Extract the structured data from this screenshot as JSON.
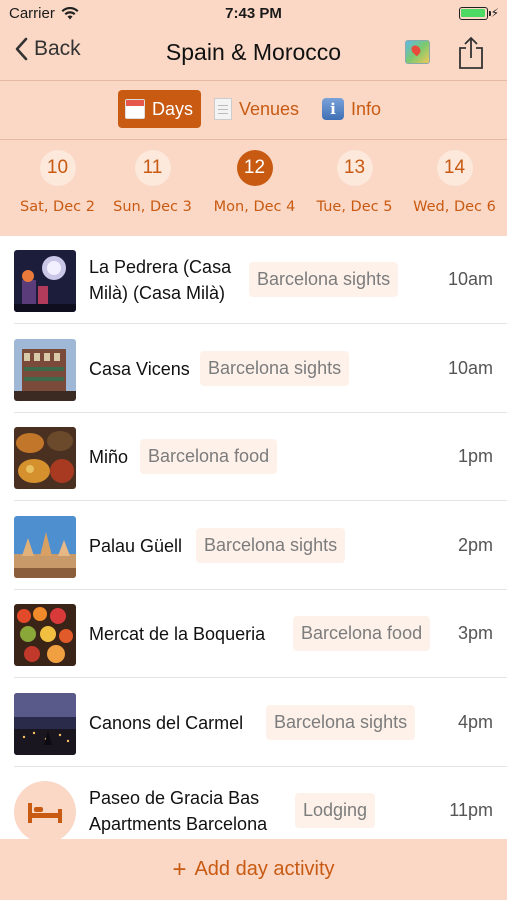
{
  "status": {
    "carrier": "Carrier",
    "time": "7:43 PM",
    "battery_level": 1.0
  },
  "nav": {
    "back_label": "Back",
    "title": "Spain & Morocco",
    "map_icon": "map-icon",
    "share_icon": "share-icon"
  },
  "segments": [
    {
      "label": "Days",
      "icon": "calendar-icon",
      "selected": true
    },
    {
      "label": "Venues",
      "icon": "document-icon",
      "selected": false
    },
    {
      "label": "Info",
      "icon": "info-icon",
      "selected": false
    }
  ],
  "days": [
    {
      "number": "10",
      "label": "Sat, Dec 2",
      "selected": false
    },
    {
      "number": "11",
      "label": "Sun, Dec 3",
      "selected": false
    },
    {
      "number": "12",
      "label": "Mon, Dec 4",
      "selected": true
    },
    {
      "number": "13",
      "label": "Tue, Dec 5",
      "selected": false
    },
    {
      "number": "14",
      "label": "Wed, Dec 6",
      "selected": false
    }
  ],
  "activities": [
    {
      "name": "La Pedrera (Casa Milà) (Casa Milà)",
      "tag": "Barcelona sights",
      "time": "10am"
    },
    {
      "name": "Casa Vicens",
      "tag": "Barcelona sights",
      "time": "10am"
    },
    {
      "name": "Miño",
      "tag": "Barcelona food",
      "time": "1pm"
    },
    {
      "name": "Palau Güell",
      "tag": "Barcelona sights",
      "time": "2pm"
    },
    {
      "name": "Mercat de la Boqueria",
      "tag": "Barcelona food",
      "time": "3pm"
    },
    {
      "name": "Canons del Carmel",
      "tag": "Barcelona sights",
      "time": "4pm"
    },
    {
      "name": "Paseo de Gracia Bas Apartments Barcelona",
      "tag": "Lodging",
      "time": "11pm"
    }
  ],
  "footer": {
    "add_label": "Add day activity"
  },
  "colors": {
    "accent": "#c85a12",
    "header_bg": "#fbd8c6",
    "tag_bg": "#fdf1ea"
  }
}
